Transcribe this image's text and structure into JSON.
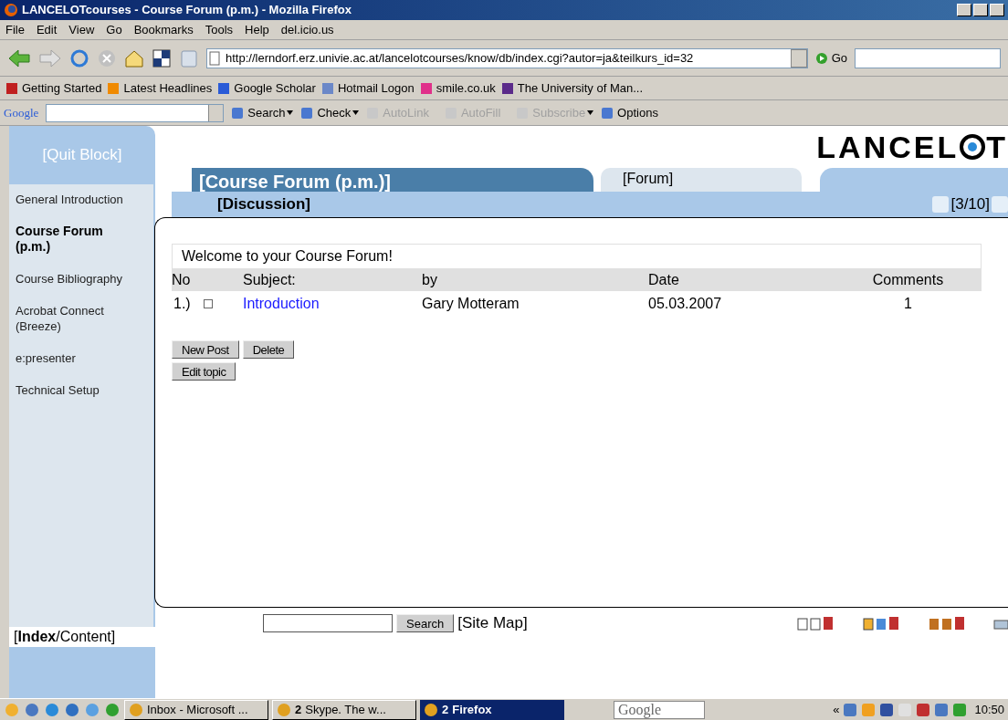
{
  "window": {
    "title": "LANCELOTcourses - Course Forum (p.m.) - Mozilla Firefox"
  },
  "menu": [
    "File",
    "Edit",
    "View",
    "Go",
    "Bookmarks",
    "Tools",
    "Help",
    "del.icio.us"
  ],
  "navigation": {
    "url": "http://lerndorf.erz.univie.ac.at/lancelotcourses/know/db/index.cgi?autor=ja&teilkurs_id=32",
    "go": "Go"
  },
  "bookmarks": [
    {
      "label": "Getting Started"
    },
    {
      "label": "Latest Headlines"
    },
    {
      "label": "Google Scholar"
    },
    {
      "label": "Hotmail Logon"
    },
    {
      "label": "smile.co.uk"
    },
    {
      "label": "The University of Man..."
    }
  ],
  "google_toolbar": {
    "brand": "Google",
    "items": [
      {
        "label": "Search",
        "disabled": false,
        "caret": true
      },
      {
        "label": "Check",
        "disabled": false,
        "caret": true
      },
      {
        "label": "AutoLink",
        "disabled": true,
        "caret": false
      },
      {
        "label": "AutoFill",
        "disabled": true,
        "caret": false
      },
      {
        "label": "Subscribe",
        "disabled": true,
        "caret": true
      },
      {
        "label": "Options",
        "disabled": false,
        "caret": false
      }
    ]
  },
  "sidebar": {
    "quit": "[Quit Block]",
    "items": [
      {
        "label": "General Introduction",
        "selected": false
      },
      {
        "label": "Course Forum (p.m.)",
        "selected": true
      },
      {
        "label": "Course Bibliography",
        "selected": false
      },
      {
        "label": "Acrobat Connect (Breeze)",
        "selected": false
      },
      {
        "label": "e:presenter",
        "selected": false
      },
      {
        "label": "Technical Setup",
        "selected": false
      }
    ],
    "footer": "[**Index**/Content]"
  },
  "header": {
    "logo_start": "LANCEL",
    "logo_end": "T",
    "tabs": [
      {
        "label": "[Course Forum (p.m.)]",
        "selected": true
      },
      {
        "label": "[Forum]",
        "selected": false
      }
    ],
    "subheading": "[Discussion]",
    "pager": "[3/10]"
  },
  "forum": {
    "welcome": "Welcome to your Course Forum!",
    "columns": [
      "No",
      "Subject:",
      "by",
      "Date",
      "Comments"
    ],
    "rows": [
      {
        "no": "1.)",
        "checked": false,
        "subject": "Introduction",
        "by": "Gary Motteram",
        "date": "05.03.2007",
        "comments": "1"
      }
    ],
    "buttons": [
      [
        "New Post",
        "Delete"
      ],
      [
        "Edit topic"
      ]
    ]
  },
  "footer": {
    "search_button": "Search",
    "site_map": "[Site Map]"
  },
  "taskbar": {
    "tasks": [
      {
        "label": "Inbox - Microsoft ...",
        "selected": false
      },
      {
        "label": "Skype. The w...",
        "selected": false,
        "count": "2"
      },
      {
        "label": "Firefox",
        "selected": true,
        "count": "2"
      }
    ],
    "search_placeholder": "Google",
    "chevron": "«",
    "clock": "10:50"
  }
}
